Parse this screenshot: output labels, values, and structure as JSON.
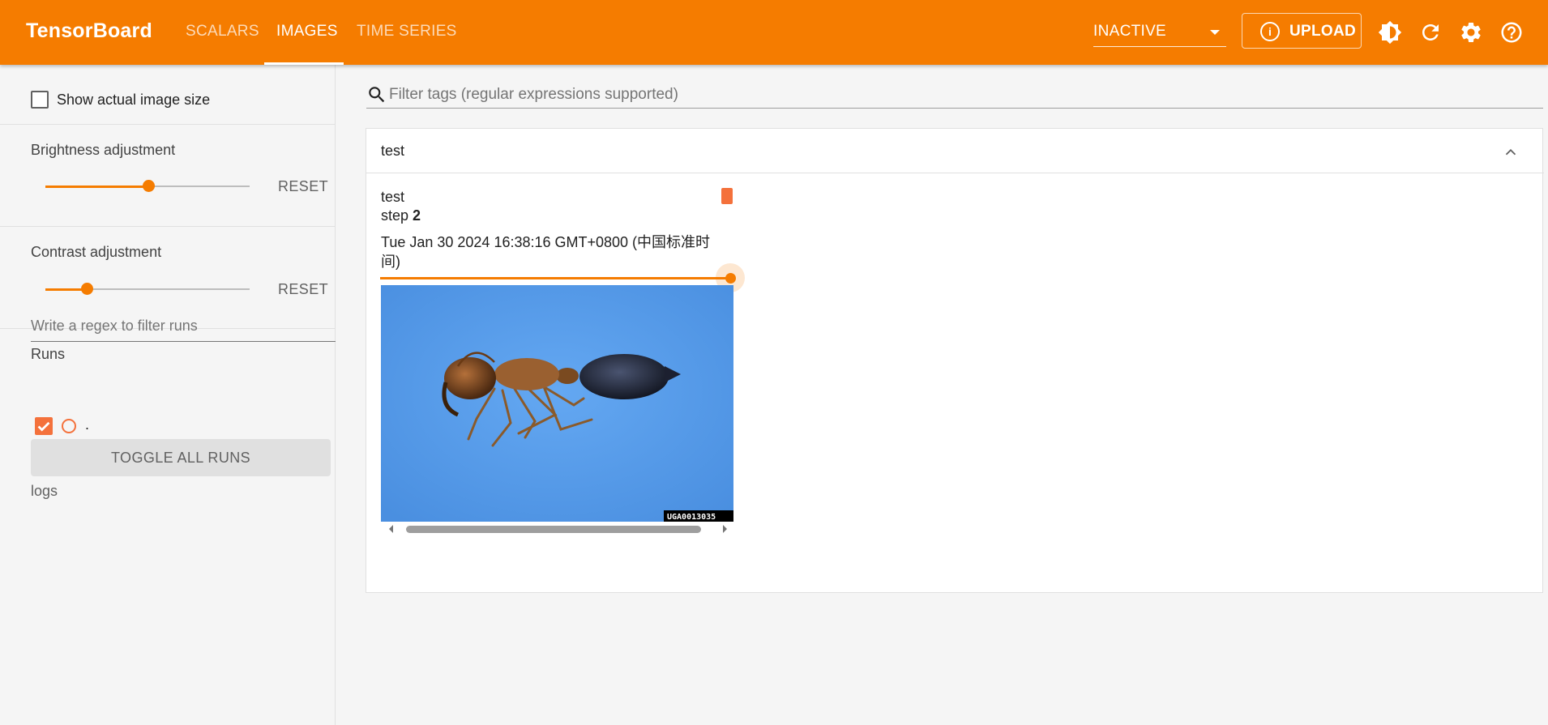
{
  "header": {
    "brand": "TensorBoard",
    "tabs": [
      {
        "label": "SCALARS",
        "active": false
      },
      {
        "label": "IMAGES",
        "active": true
      },
      {
        "label": "TIME SERIES",
        "active": false
      }
    ],
    "run_status": "INACTIVE",
    "upload_label": "UPLOAD",
    "icons": [
      "theme-icon",
      "refresh-icon",
      "settings-icon",
      "help-icon"
    ]
  },
  "sidebar": {
    "show_actual_size_label": "Show actual image size",
    "show_actual_size_checked": false,
    "brightness": {
      "label": "Brightness adjustment",
      "value": 0.5,
      "reset": "RESET"
    },
    "contrast": {
      "label": "Contrast adjustment",
      "value": 0.2,
      "reset": "RESET"
    },
    "runs": {
      "heading": "Runs",
      "filter_placeholder": "Write a regex to filter runs",
      "items": [
        {
          "name": ".",
          "checked": true,
          "color": "#f4713b"
        }
      ],
      "toggle_all": "TOGGLE ALL RUNS",
      "log_dir": "logs"
    }
  },
  "main": {
    "filter_placeholder": "Filter tags (regular expressions supported)",
    "card": {
      "title": "test",
      "pane": {
        "tag": "test",
        "step_prefix": "step",
        "step": "2",
        "timestamp_line1": "Tue Jan 30 2024 16:38:16 GMT+0800 (中国标准时",
        "timestamp_line2": "间)",
        "image_watermark": "UGA0013035",
        "step_slider_value": 1.0
      }
    }
  },
  "colors": {
    "accent": "#f57c00",
    "run": "#f4713b"
  }
}
